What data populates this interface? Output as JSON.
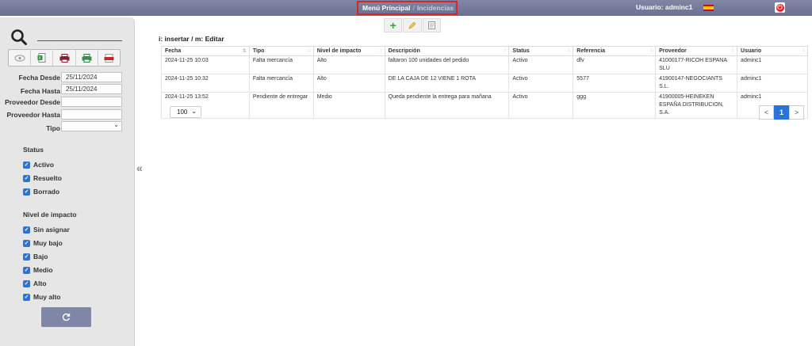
{
  "header": {
    "breadcrumb_home": "Menú Principal",
    "breadcrumb_separator": "/",
    "breadcrumb_current": "Incidencias",
    "user_label": "Usuario: adminc1",
    "language_flag_icon": "spain-flag-icon",
    "logout_icon": "power-icon"
  },
  "sidebar": {
    "search_icon": "search-icon",
    "tools": [
      "eye-icon",
      "excel-icon",
      "printer-icon",
      "print-preview-icon",
      "pdf-icon"
    ],
    "filters": {
      "fecha_desde_label": "Fecha Desde",
      "fecha_desde_value": "25/11/2024",
      "fecha_hasta_label": "Fecha Hasta",
      "fecha_hasta_value": "25/11/2024",
      "proveedor_desde_label": "Proveedor Desde",
      "proveedor_desde_value": "",
      "proveedor_hasta_label": "Proveedor Hasta",
      "proveedor_hasta_value": "",
      "tipo_label": "Tipo",
      "tipo_value": ""
    },
    "status_title": "Status",
    "status_items": [
      "Activo",
      "Resuelto",
      "Borrado"
    ],
    "impact_title": "Nivel de impacto",
    "impact_items": [
      "Sin asignar",
      "Muy bajo",
      "Bajo",
      "Medio",
      "Alto",
      "Muy alto"
    ],
    "refresh_icon": "refresh-icon",
    "collapse_glyph": "«"
  },
  "main": {
    "toolbar": [
      "add-icon",
      "edit-icon",
      "document-icon"
    ],
    "hint": "i: insertar / m: Editar",
    "columns": [
      "Fecha",
      "Tipo",
      "Nivel de impacto",
      "Descripción",
      "Status",
      "Referencia",
      "Proveedor",
      "Usuario"
    ],
    "rows": [
      [
        "2024-11-25 10:03",
        "Falta mercancía",
        "Alto",
        "faltaron 100 unidades del pedido",
        "Activo",
        "dfv",
        "41000177-RICOH ESPANA SLU",
        "adminc1"
      ],
      [
        "2024-11-25 10:32",
        "Falta mercancía",
        "Alto",
        "DE LA CAJA DE 12 VIENE 1 ROTA",
        "Activo",
        "5577",
        "41900147-NEGOCIANTS S.L.",
        "adminc1"
      ],
      [
        "2024-11-25 13:52",
        "Pendiente de entregar",
        "Medio",
        "Queda pendiente la entrega para mañana",
        "Activo",
        "ggg",
        "41900005-HEINEKEN ESPAÑA DISTRIBUCION, S.A.",
        "adminc1"
      ]
    ],
    "page_size": "100",
    "pager": {
      "prev": "<",
      "current": "1",
      "next": ">"
    }
  },
  "colors": {
    "topbar": "#6b7091",
    "accent_blue": "#2a74d8",
    "highlight_red": "#d9252a",
    "button": "#7f86a8"
  }
}
